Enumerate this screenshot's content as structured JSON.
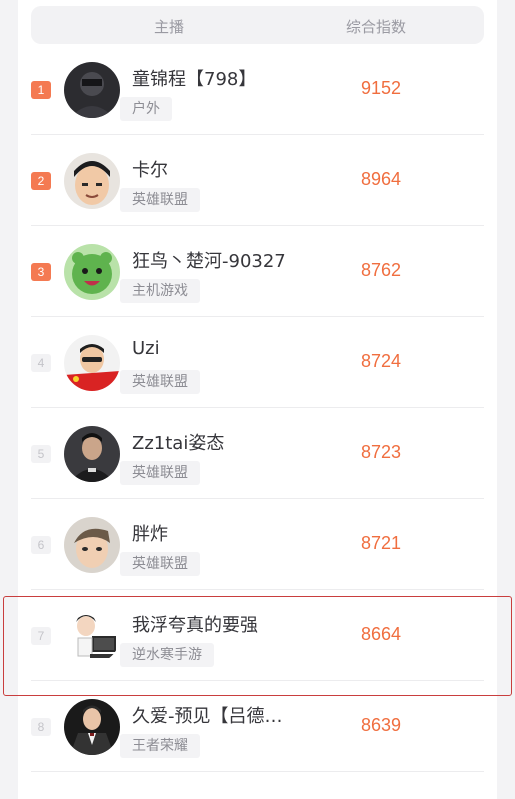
{
  "header": {
    "col_anchor": "主播",
    "col_index": "综合指数"
  },
  "rows": [
    {
      "rank": "1",
      "name": "童锦程【798】",
      "category": "户外",
      "score": "9152",
      "avatar_icon": "avatar-dark-icon"
    },
    {
      "rank": "2",
      "name": "卡尔",
      "category": "英雄联盟",
      "score": "8964",
      "avatar_icon": "avatar-face-icon"
    },
    {
      "rank": "3",
      "name": "狂鸟丶楚河-90327",
      "category": "主机游戏",
      "score": "8762",
      "avatar_icon": "avatar-green-cartoon-icon"
    },
    {
      "rank": "4",
      "name": "Uzi",
      "category": "英雄联盟",
      "score": "8724",
      "avatar_icon": "avatar-flag-icon"
    },
    {
      "rank": "5",
      "name": "Zz1tai姿态",
      "category": "英雄联盟",
      "score": "8723",
      "avatar_icon": "avatar-dark-icon"
    },
    {
      "rank": "6",
      "name": "胖炸",
      "category": "英雄联盟",
      "score": "8721",
      "avatar_icon": "avatar-face-icon"
    },
    {
      "rank": "7",
      "name": "我浮夸真的要强",
      "category": "逆水寒手游",
      "score": "8664",
      "avatar_icon": "avatar-cartoon-computer-icon"
    },
    {
      "rank": "8",
      "name": "久爱-预见【吕德…",
      "category": "王者荣耀",
      "score": "8639",
      "avatar_icon": "avatar-suit-icon"
    }
  ],
  "colors": {
    "accent": "#f06e3f",
    "rank_top": "#f47a52",
    "highlight_border": "#c93e3e"
  }
}
